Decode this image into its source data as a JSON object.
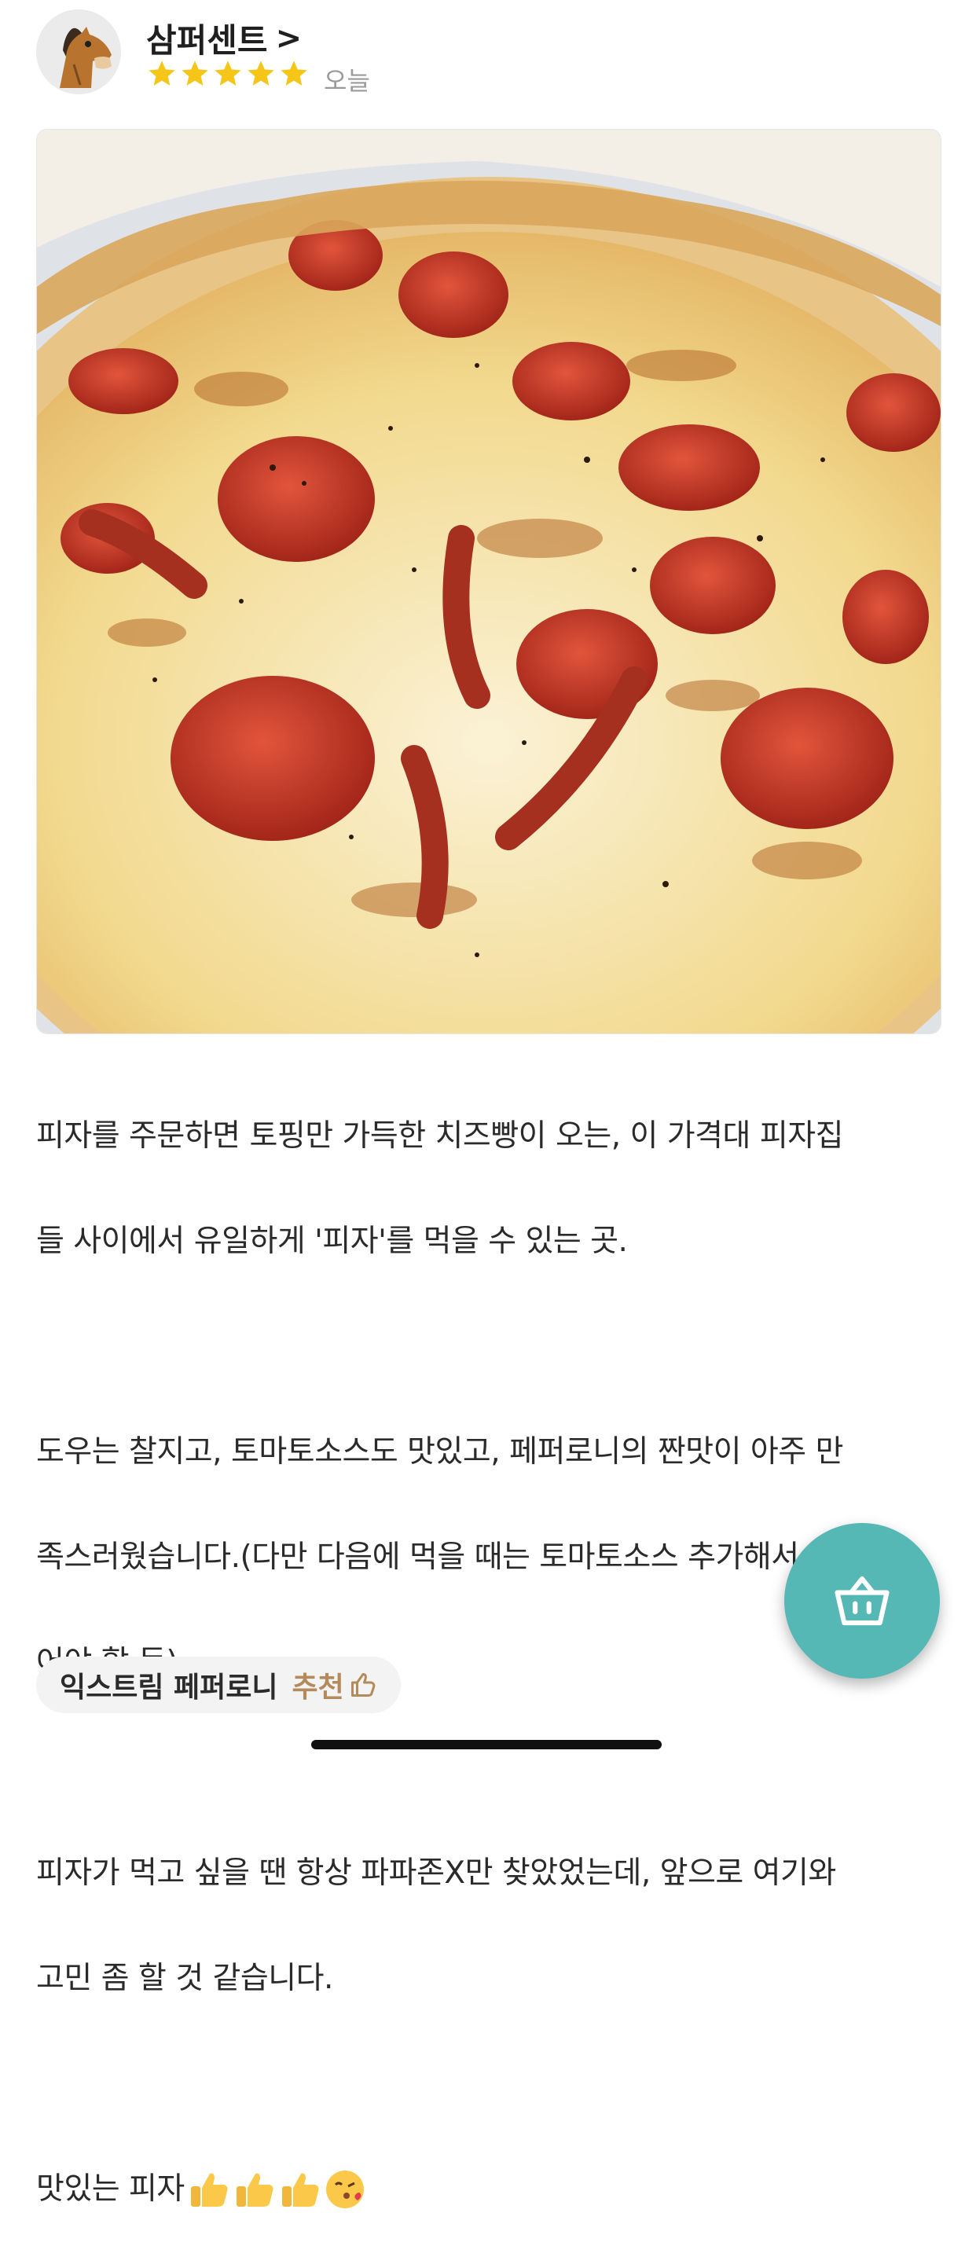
{
  "reviewer": {
    "name": "삼퍼센트",
    "chevron": ">",
    "avatar_icon": "horse-avatar-icon",
    "rating": 5,
    "max_rating": 5,
    "date": "오늘"
  },
  "photo": {
    "icon": "pepperoni-pizza-photo"
  },
  "review": {
    "lines": [
      "피자를 주문하면 토핑만 가득한 치즈빵이 오는, 이 가격대 피자집",
      "들 사이에서 유일하게 '피자'를 먹을 수 있는 곳.",
      "",
      "도우는 찰지고, 토마토소스도 맛있고, 페퍼로니의 짠맛이 아주 만",
      "족스러웠습니다.(다만 다음에 먹을 때는 토마토소스 추가해서 먹",
      "어야 할 듯)",
      "",
      "피자가 먹고 싶을 땐 항상 파파존X만 찾았었는데, 앞으로 여기와",
      "고민 좀 할 것 같습니다.",
      "",
      "맛있는 피자"
    ],
    "emojis": [
      "thumbs-up-icon",
      "thumbs-up-icon",
      "thumbs-up-icon",
      "kissing-face-icon"
    ]
  },
  "menu_tag": {
    "name": "익스트림 페퍼로니",
    "recommend_label": "추천",
    "recommend_icon": "thumbs-up-outline-icon"
  },
  "fab": {
    "icon": "shopping-basket-icon",
    "color": "#56b8b4"
  },
  "colors": {
    "star": "#f5c518",
    "recommend": "#b48a5a"
  }
}
